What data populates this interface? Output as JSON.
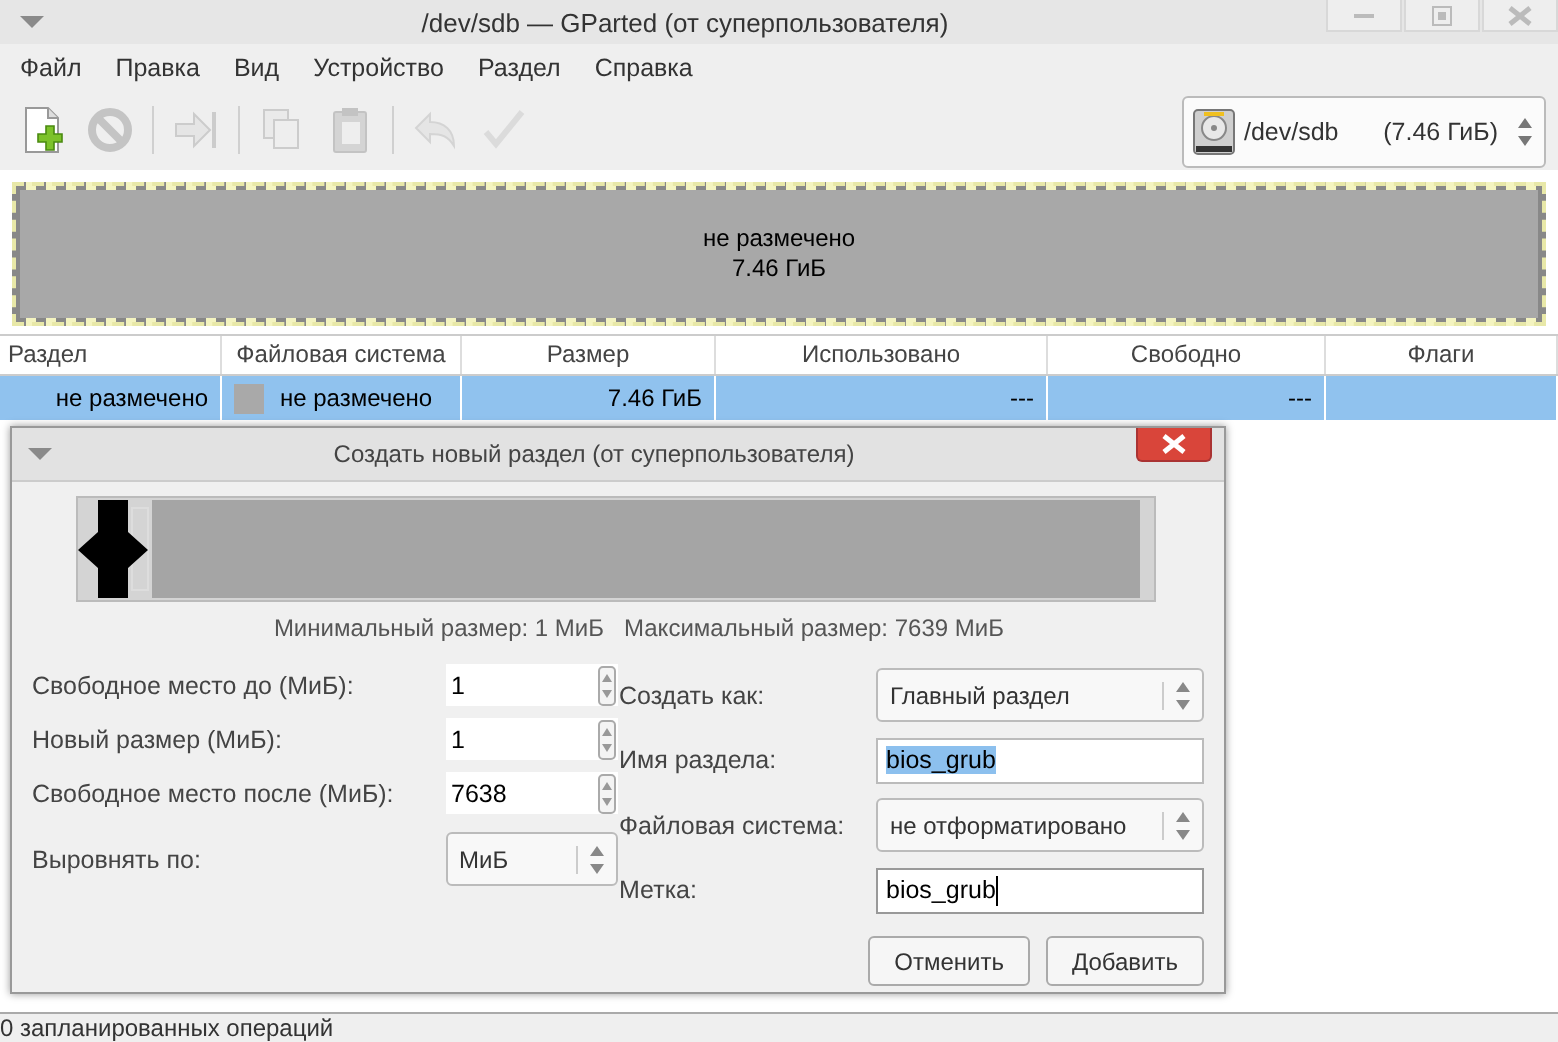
{
  "window": {
    "title": "/dev/sdb — GParted (от суперпользователя)"
  },
  "menu": [
    "Файл",
    "Правка",
    "Вид",
    "Устройство",
    "Раздел",
    "Справка"
  ],
  "toolbar": [
    {
      "kind": "new",
      "disabled": false
    },
    {
      "kind": "delete",
      "disabled": true
    },
    {
      "kind": "resize",
      "disabled": true
    },
    {
      "kind": "copy",
      "disabled": true
    },
    {
      "kind": "paste",
      "disabled": true
    },
    {
      "kind": "undo",
      "disabled": true
    },
    {
      "kind": "apply",
      "disabled": true
    }
  ],
  "device_selector": {
    "device": "/dev/sdb",
    "size": "(7.46 ГиБ)"
  },
  "disk_map": {
    "label": "не размечено",
    "size": "7.46 ГиБ"
  },
  "table": {
    "columns": [
      "Раздел",
      "Файловая система",
      "Размер",
      "Использовано",
      "Свободно",
      "Флаги"
    ],
    "rows": [
      {
        "partition": "не размечено",
        "filesystem": "не размечено",
        "color": "#a9a9a9",
        "size": "7.46 ГиБ",
        "used": "---",
        "free": "---",
        "selected": true
      }
    ]
  },
  "dialog": {
    "title": "Создать новый раздел (от суперпользователя)",
    "min_size": "Минимальный размер: 1 МиБ",
    "max_size": "Максимальный размер: 7639 МиБ",
    "left_fields": [
      {
        "kind": "spin",
        "label": "Свободное место до (МиБ):",
        "value": "1"
      },
      {
        "kind": "spin",
        "label": "Новый размер (МиБ):",
        "value": "1"
      },
      {
        "kind": "spin",
        "label": "Свободное место после (МиБ):",
        "value": "7638"
      },
      {
        "kind": "combo",
        "label": "Выровнять по:",
        "value": "МиБ"
      }
    ],
    "right_fields": [
      {
        "kind": "combo",
        "label": "Создать как:",
        "value": "Главный раздел"
      },
      {
        "kind": "entry",
        "label": "Имя раздела:",
        "value": "bios_grub",
        "text_selected": true,
        "focused": false
      },
      {
        "kind": "combo",
        "label": "Файловая система:",
        "value": "не отформатировано"
      },
      {
        "kind": "entry",
        "label": "Метка:",
        "value": "bios_grub",
        "text_selected": false,
        "focused": true
      }
    ],
    "buttons": [
      "Отменить",
      "Добавить"
    ]
  },
  "status_bar": "0 запланированных операций"
}
